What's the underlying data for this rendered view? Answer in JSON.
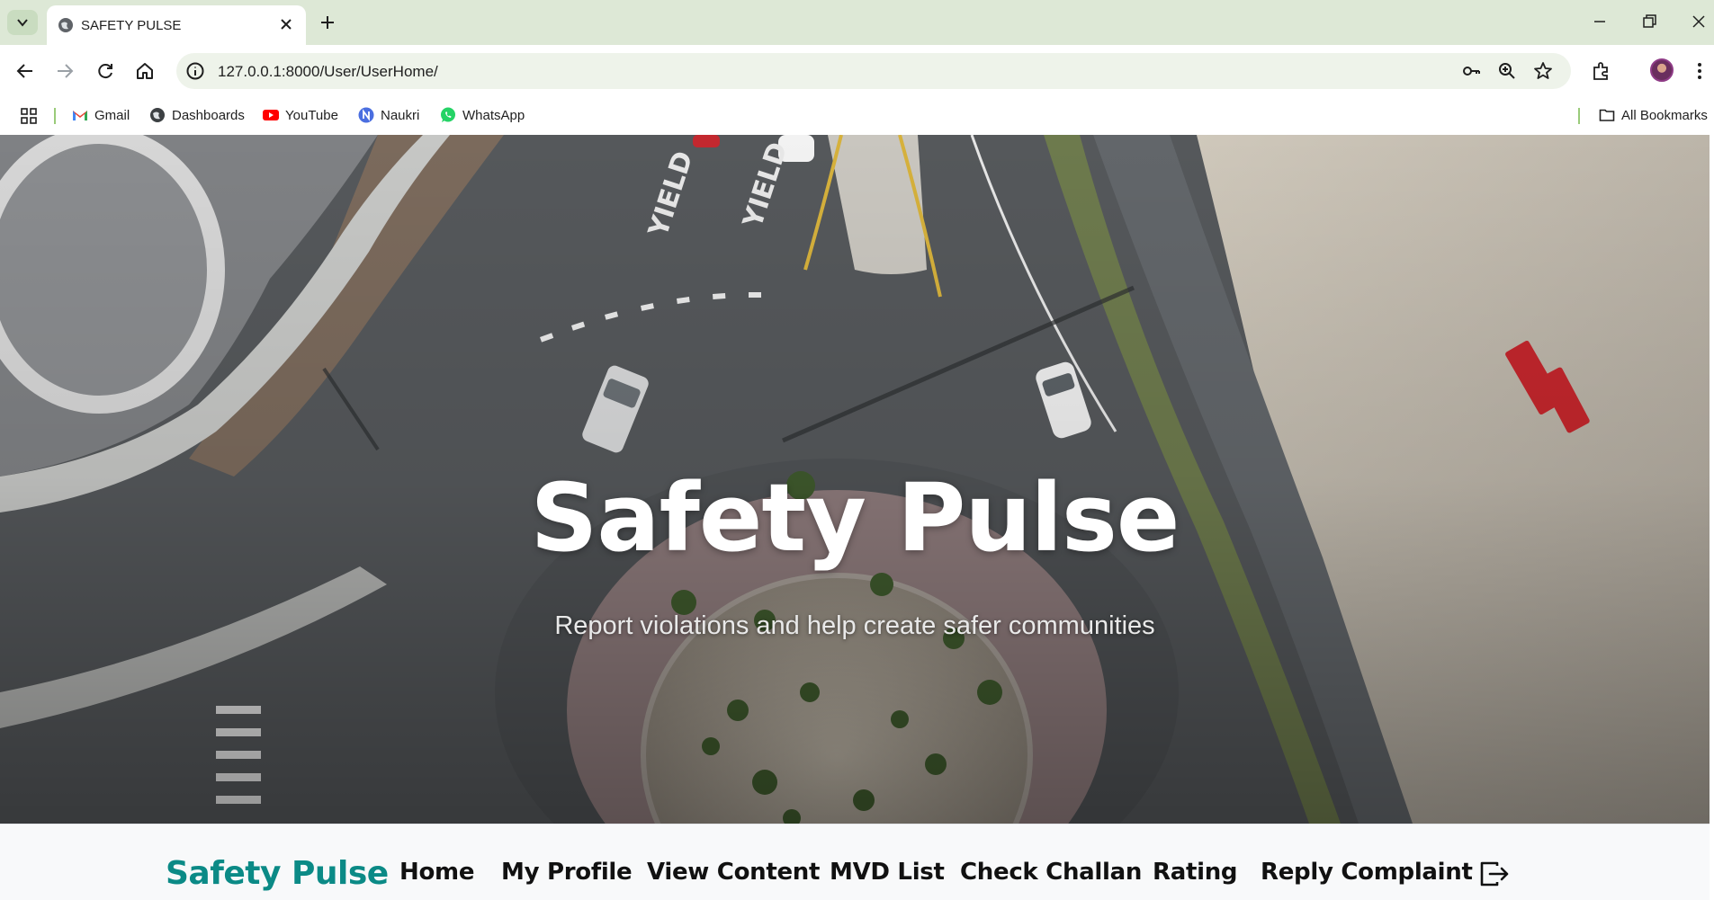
{
  "browser": {
    "tab_title": "SAFETY PULSE",
    "url": "127.0.0.1:8000/User/UserHome/",
    "bookmarks": [
      {
        "label": "Gmail",
        "icon": "gmail-icon"
      },
      {
        "label": "Dashboards",
        "icon": "globe-icon"
      },
      {
        "label": "YouTube",
        "icon": "youtube-icon"
      },
      {
        "label": "Naukri",
        "icon": "naukri-icon"
      },
      {
        "label": "WhatsApp",
        "icon": "whatsapp-icon"
      }
    ],
    "all_bookmarks_label": "All Bookmarks"
  },
  "hero": {
    "title": "Safety Pulse",
    "subtitle": "Report violations and help create safer communities"
  },
  "nav": {
    "brand": "Safety Pulse",
    "links": [
      "Home",
      "My Profile",
      "View Content",
      "MVD List",
      "Check Challan",
      "Rating",
      "Reply Complaint"
    ],
    "logout_icon": "logout-icon"
  },
  "colors": {
    "chrome_bg": "#dde8d6",
    "brand": "#0b8a86",
    "nav_bg": "#f8f9fa"
  }
}
